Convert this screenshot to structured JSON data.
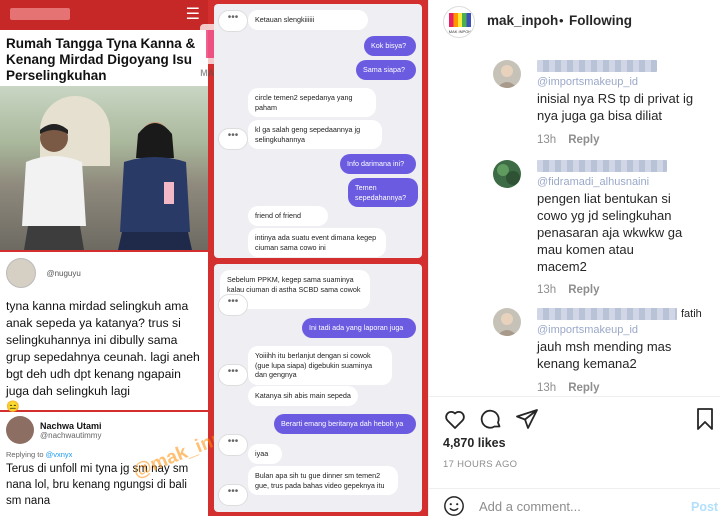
{
  "news": {
    "title": "Rumah Tangga Tyna Kanna & Kenang Mirdad Digoyang Isu Perselingkuhan"
  },
  "logo_text": "MAK INPOH",
  "tweet1": {
    "handle": "@nuguyu",
    "body": "tyna kanna mirdad selingkuh ama anak sepeda ya katanya? trus si selingkuhannya ini dibully sama grup sepedahnya ceunah. lagi aneh bgt deh udh dpt kenang ngapain juga dah selingkuh lagi"
  },
  "tweet2": {
    "name": "Nachwa Utami",
    "handle": "@nachwautimmy",
    "reply_prefix": "Replying to",
    "reply_to": "@vxnyx",
    "body": "Terus di unfoll mi tyna jg sm nay sm nana lol, bru kenang ngungsi di bali sm nana"
  },
  "watermark": "@mak_inpoh",
  "chat1": {
    "messages": [
      {
        "from": "in",
        "text": "Ketauan slengkiiiiii"
      },
      {
        "from": "out",
        "text": "Kok bisya?"
      },
      {
        "from": "out",
        "text": "Sama siapa?"
      },
      {
        "from": "in",
        "text": "circle temen2 sepedanya yang paham"
      },
      {
        "from": "in",
        "text": "kl ga salah geng sepedaannya jg selingkuhannya"
      },
      {
        "from": "out",
        "text": "Info darimana ini?"
      },
      {
        "from": "out",
        "text": "Temen sepedahannya?"
      },
      {
        "from": "in",
        "text": "friend of friend"
      },
      {
        "from": "in",
        "text": "intinya ada suatu event dimana kegep ciuman sama cowo ini"
      }
    ]
  },
  "chat2": {
    "messages": [
      {
        "from": "in",
        "text": "Sebelum PPKM, kegep sama suaminya kalau ciuman di astha SCBD sama cowok lain."
      },
      {
        "from": "out",
        "text": "Ini tadi ada yang laporan juga"
      },
      {
        "from": "in",
        "text": "Yoiiihh itu berlanjut dengan si cowok (gue lupa siapa) digebukin suaminya dan gengnya"
      },
      {
        "from": "in",
        "text": "Katanya sih abis main sepeda"
      },
      {
        "from": "out",
        "text": "Berarti emang beritanya dah heboh ya"
      },
      {
        "from": "in",
        "text": "iyaa"
      },
      {
        "from": "in",
        "text": "Bulan apa sih tu gue dinner sm temen2 gue, trus pada bahas video gepeknya itu"
      }
    ]
  },
  "ig": {
    "username": "mak_inpoh",
    "follow_status": "Following",
    "dot": "•",
    "avatar_caption": "MAK INPOH",
    "comments": [
      {
        "mention": "@importsmakeup_id",
        "text": "inisial nya RS tp di privat ig nya juga ga bisa diliat",
        "time": "13h",
        "reply": "Reply"
      },
      {
        "mention": "@fidramadi_alhusnaini",
        "text": "pengen liat bentukan si cowo yg jd selingkuhan penasaran aja wkwkw ga mau komen atau macem2",
        "time": "13h",
        "reply": "Reply"
      },
      {
        "mention": "@importsmakeup_id",
        "text": "jauh msh mending mas kenang kemana2",
        "time": "13h",
        "reply": "Reply",
        "name_tail": "fatih"
      }
    ],
    "likes": "4,870 likes",
    "time_ago": "17 HOURS AGO",
    "comment_placeholder": "Add a comment...",
    "post_label": "Post"
  },
  "colors": {
    "accent": "#0095f6",
    "post_disabled": "#b2dffc",
    "chat_out": "#6b5be0",
    "collage_border": "#d32f2f"
  }
}
